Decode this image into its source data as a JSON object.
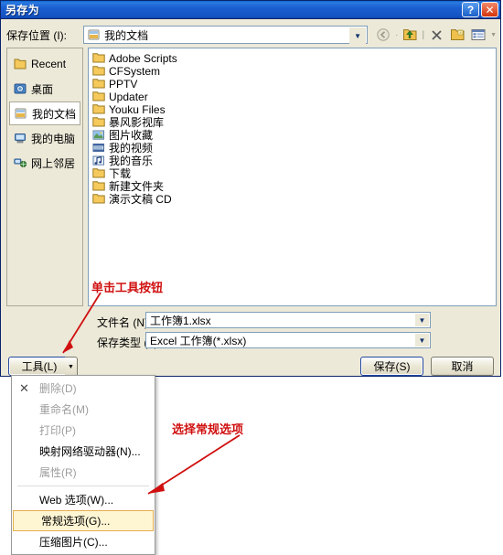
{
  "window": {
    "title": "另存为",
    "help_button": "?",
    "close_button": "✕"
  },
  "lookin": {
    "label": "保存位置 (I):",
    "value": "我的文档",
    "dropdown_arrow": "▼",
    "toolbar": [
      {
        "name": "back-icon",
        "glyph": "◄",
        "disabled": true
      },
      {
        "name": "up-folder-icon",
        "glyph": "↑"
      },
      {
        "name": "delete-icon",
        "glyph": "✕"
      },
      {
        "name": "new-folder-icon",
        "glyph": "▤"
      },
      {
        "name": "views-icon",
        "glyph": "▦"
      }
    ]
  },
  "places": {
    "items": [
      {
        "label": "Recent",
        "icon": "recent-folder-icon",
        "selected": false
      },
      {
        "label": "桌面",
        "icon": "desktop-icon",
        "selected": false
      },
      {
        "label": "我的文档",
        "icon": "my-documents-icon",
        "selected": true
      },
      {
        "label": "我的电脑",
        "icon": "my-computer-icon",
        "selected": false
      },
      {
        "label": "网上邻居",
        "icon": "network-places-icon",
        "selected": false
      }
    ]
  },
  "filelist": {
    "items": [
      {
        "name": "Adobe Scripts",
        "icon": "folder-icon"
      },
      {
        "name": "CFSystem",
        "icon": "folder-icon"
      },
      {
        "name": "PPTV",
        "icon": "folder-icon"
      },
      {
        "name": "Updater",
        "icon": "folder-icon"
      },
      {
        "name": "Youku Files",
        "icon": "folder-icon"
      },
      {
        "name": "暴风影视库",
        "icon": "folder-icon"
      },
      {
        "name": "图片收藏",
        "icon": "pictures-folder-icon"
      },
      {
        "name": "我的视频",
        "icon": "video-folder-icon"
      },
      {
        "name": "我的音乐",
        "icon": "music-folder-icon"
      },
      {
        "name": "下载",
        "icon": "folder-icon"
      },
      {
        "name": "新建文件夹",
        "icon": "folder-icon"
      },
      {
        "name": "演示文稿 CD",
        "icon": "folder-icon"
      }
    ]
  },
  "fields": {
    "filename_label": "文件名 (N):",
    "filename_value": "工作簿1.xlsx",
    "filetype_label": "保存类型 (T):",
    "filetype_value": "Excel 工作簿(*.xlsx)",
    "dropdown_arrow": "▼"
  },
  "buttons": {
    "tools": "工具(L)",
    "tools_arrow": "▼",
    "save": "保存(S)",
    "cancel": "取消"
  },
  "tools_menu": {
    "items": [
      {
        "label": "删除(D)",
        "disabled": true,
        "glyph": "✕",
        "separator_after": false
      },
      {
        "label": "重命名(M)",
        "disabled": true,
        "glyph": "",
        "separator_after": false
      },
      {
        "label": "打印(P)",
        "disabled": true,
        "glyph": "",
        "separator_after": false
      },
      {
        "label": "映射网络驱动器(N)...",
        "disabled": false,
        "glyph": "",
        "separator_after": false
      },
      {
        "label": "属性(R)",
        "disabled": true,
        "glyph": "",
        "separator_after": true
      },
      {
        "label": "Web 选项(W)...",
        "disabled": false,
        "glyph": "",
        "separator_after": false
      },
      {
        "label": "常规选项(G)...",
        "disabled": false,
        "glyph": "",
        "highlighted": true,
        "separator_after": false
      },
      {
        "label": "压缩图片(C)...",
        "disabled": false,
        "glyph": "",
        "separator_after": false
      }
    ]
  },
  "annotations": [
    {
      "text": "单击工具按钮",
      "color": "#d01010"
    },
    {
      "text": "选择常规选项",
      "color": "#d01010"
    }
  ]
}
